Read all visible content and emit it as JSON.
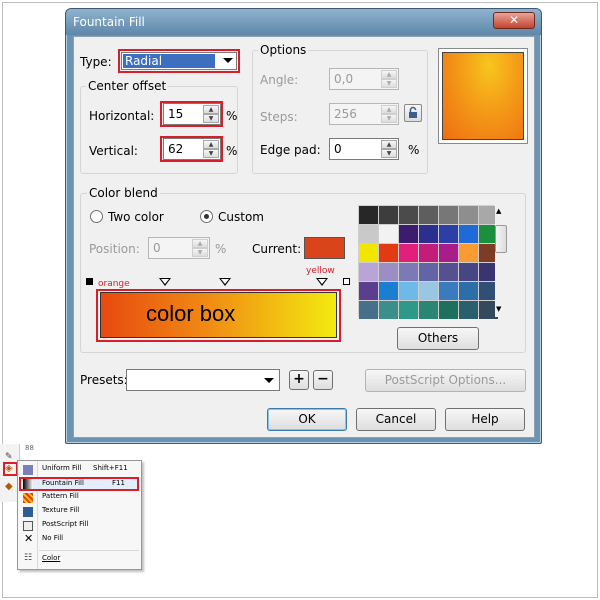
{
  "dialog": {
    "title": "Fountain Fill",
    "close_glyph": "✕",
    "type_label": "Type:",
    "type_value": "Radial",
    "center_offset_label": "Center offset",
    "horizontal_label": "Horizontal:",
    "horizontal_value": "15",
    "vertical_label": "Vertical:",
    "vertical_value": "62",
    "percent": "%",
    "options_label": "Options",
    "angle_label": "Angle:",
    "angle_value": "0,0",
    "steps_label": "Steps:",
    "steps_value": "256",
    "edge_pad_label": "Edge pad:",
    "edge_pad_value": "0",
    "color_blend_label": "Color blend",
    "two_color_label": "Two color",
    "custom_label": "Custom",
    "position_label": "Position:",
    "position_value": "0",
    "current_label": "Current:",
    "current_color": "#d9441a",
    "orange_annotation": "orange",
    "yellow_annotation": "yellow",
    "color_box_annotation": "color box",
    "others_button": "Others",
    "presets_label": "Presets:",
    "postscript_button": "PostScript Options...",
    "ok_button": "OK",
    "cancel_button": "Cancel",
    "help_button": "Help",
    "add_preset_glyph": "+",
    "remove_preset_glyph": "−"
  },
  "colors": {
    "annotation_red": "#d71f2b",
    "gradient_start": "#e84a10",
    "gradient_end": "#f3ea10",
    "preview_outer": "#f06a12",
    "preview_inner": "#f7c61d",
    "palette": [
      "#272727",
      "#3d3d3d",
      "#4b4b4b",
      "#5e5e5e",
      "#777777",
      "#8e8e8e",
      "#a8a8a8",
      "#c9c9c9",
      "#f2f2f2",
      "#3b1c6e",
      "#2b2f8f",
      "#2c3fa6",
      "#1e6bd8",
      "#1a8f3c",
      "#f2e600",
      "#e23a12",
      "#e0207a",
      "#c31d7c",
      "#a91d8a",
      "#f79b32",
      "#7f3c24",
      "#b9a4d6",
      "#9c8dc7",
      "#7d78b6",
      "#6265a4",
      "#55508f",
      "#474584",
      "#3a3572",
      "#5b3e8c",
      "#1b7fd1",
      "#6fb9e8",
      "#98c6e3",
      "#3a7bbf",
      "#2c6fa8",
      "#314e77",
      "#46708a",
      "#3b8f8a",
      "#2e9988",
      "#2a8572",
      "#1e6f5c",
      "#2b5f6e",
      "#34495e"
    ]
  },
  "menu": {
    "items": [
      {
        "label": "Uniform Fill",
        "shortcut": "Shift+F11"
      },
      {
        "label": "Fountain Fill",
        "shortcut": "F11"
      },
      {
        "label": "Pattern Fill",
        "shortcut": ""
      },
      {
        "label": "Texture Fill",
        "shortcut": ""
      },
      {
        "label": "PostScript Fill",
        "shortcut": ""
      },
      {
        "label": "No Fill",
        "shortcut": ""
      },
      {
        "label": "Color",
        "shortcut": ""
      }
    ]
  }
}
